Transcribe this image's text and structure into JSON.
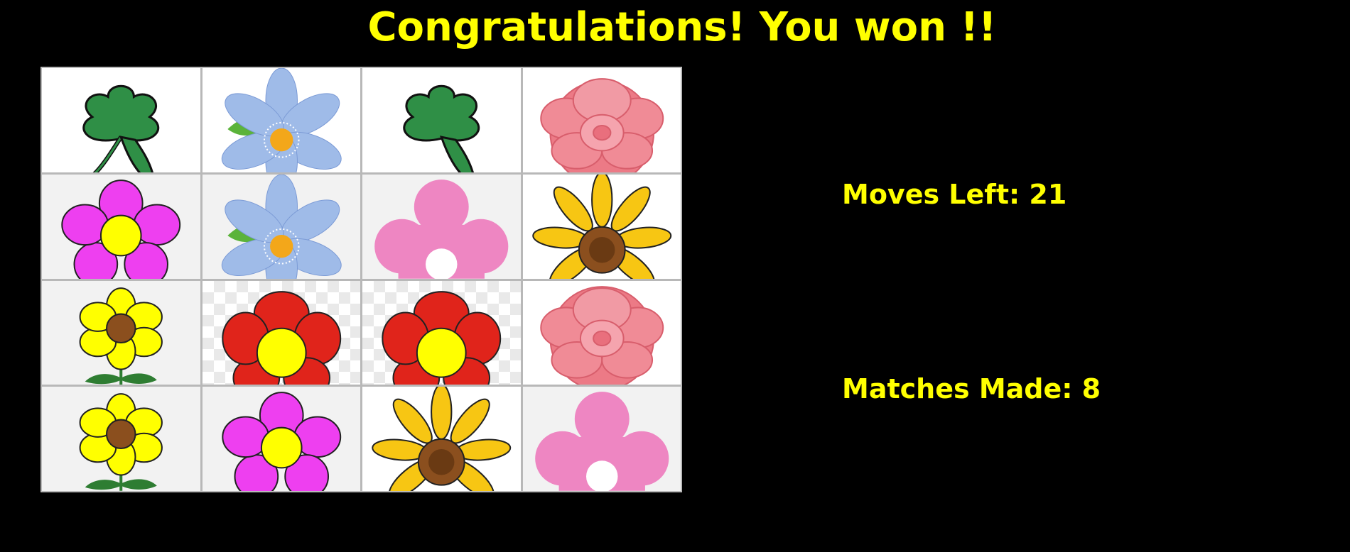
{
  "title": "Congratulations! You won !!",
  "moves_left": {
    "label": "Moves Left:",
    "value": "21",
    "text": "Moves Left: 21"
  },
  "matches_made": {
    "label": "Matches Made:",
    "value": "8",
    "text": "Matches Made: 8"
  },
  "colors": {
    "background": "#000000",
    "text": "#ffff00",
    "board_border": "#b8b8b8"
  },
  "board": {
    "rows": 4,
    "columns": 4,
    "cards": [
      [
        "green-clover-icon",
        "blue-flower-icon",
        "green-clover-icon",
        "pink-rose-icon"
      ],
      [
        "magenta-flower-icon",
        "blue-flower-icon",
        "pink-blossom-icon",
        "sunflower-icon"
      ],
      [
        "yellow-daisy-icon",
        "red-flower-icon",
        "red-flower-icon",
        "pink-rose-icon"
      ],
      [
        "yellow-daisy-icon",
        "magenta-flower-icon",
        "sunflower-icon",
        "pink-blossom-icon"
      ]
    ]
  }
}
